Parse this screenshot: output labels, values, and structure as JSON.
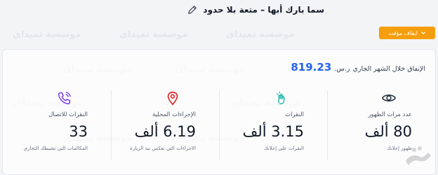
{
  "header": {
    "title": "سما بارك أبها – متعة بلا حدود",
    "edit_icon": "pencil-icon"
  },
  "actions": {
    "pause_label": "ايقاف مؤقت"
  },
  "spend": {
    "label": "الإنفاق خلال الشهر الجاري",
    "currency": "ر.س.",
    "value": "819.23"
  },
  "metrics": [
    {
      "icon": "eye-icon",
      "label": "عدد مرات الظهور",
      "value": "80 ألف",
      "sub": "ظهور إعلانك"
    },
    {
      "icon": "tap-icon",
      "label": "النقرات",
      "value": "3.15 ألف",
      "sub": "النقرات على إعلانك"
    },
    {
      "icon": "location-pin-icon",
      "label": "الإجراءات المحلية",
      "value": "6.19 ألف",
      "sub": "الاجراءات التي تعكس نية الزيارة"
    },
    {
      "icon": "phone-call-icon",
      "label": "النقرات للاتصال",
      "value": "33",
      "sub": "المكالمات التي تشيطك التجاري"
    }
  ],
  "watermark": "موسسة تميداى",
  "colors": {
    "accent": "#2563eb",
    "button": "#f59e0b",
    "icon_red": "#dc2626",
    "icon_purple": "#7c3aed",
    "icon_teal": "#14b8a6"
  }
}
